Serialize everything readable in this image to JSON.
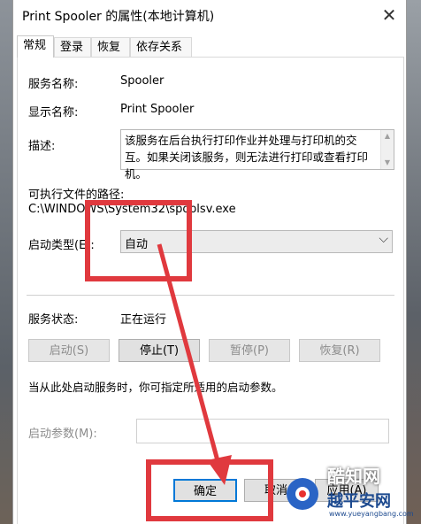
{
  "window": {
    "title": "Print Spooler 的属性(本地计算机)",
    "close_glyph": "✕"
  },
  "tabs": [
    {
      "label": "常规",
      "active": true
    },
    {
      "label": "登录",
      "active": false
    },
    {
      "label": "恢复",
      "active": false
    },
    {
      "label": "依存关系",
      "active": false
    }
  ],
  "general": {
    "service_name_label": "服务名称:",
    "service_name": "Spooler",
    "display_name_label": "显示名称:",
    "display_name": "Print Spooler",
    "description_label": "描述:",
    "description": "该服务在后台执行打印作业并处理与打印机的交互。如果关闭该服务，则无法进行打印或查看打印机。",
    "path_label": "可执行文件的路径:",
    "path": "C:\\WINDOWS\\System32\\spoolsv.exe",
    "startup_type_label": "启动类型(E):",
    "startup_type": "自动",
    "status_label": "服务状态:",
    "status": "正在运行",
    "buttons": {
      "start": "启动(S)",
      "stop": "停止(T)",
      "pause": "暂停(P)",
      "resume": "恢复(R)"
    },
    "hint": "当从此处启动服务时，你可指定所适用的启动参数。",
    "param_label": "启动参数(M):",
    "param_value": ""
  },
  "footer": {
    "ok": "确定",
    "cancel": "取消",
    "apply": "应用(A)"
  },
  "watermark": {
    "brand": "酷知网",
    "site": "越平安网",
    "url": "www.yueyangbang.com"
  },
  "colors": {
    "annotation": "#e0393e",
    "focus": "#0078d7"
  },
  "icons": {
    "close": "close-icon",
    "dropdown": "chevron-down-icon"
  }
}
